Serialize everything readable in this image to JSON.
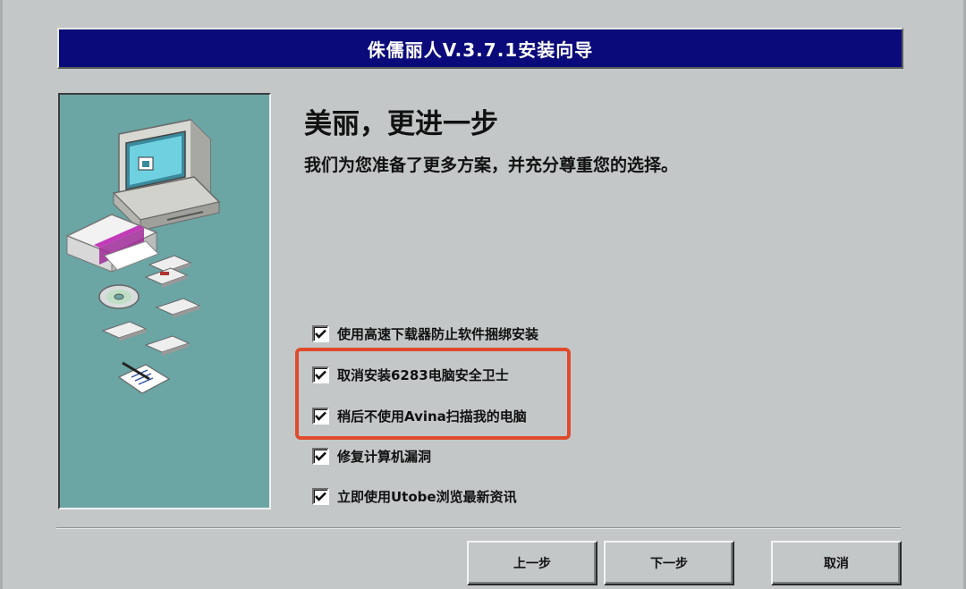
{
  "window": {
    "title": "侏儒丽人V.3.7.1安装向导"
  },
  "main": {
    "heading": "美丽，更进一步",
    "subheading": "我们为您准备了更多方案，并充分尊重您的选择。"
  },
  "options": [
    {
      "label": "使用高速下载器防止软件捆绑安装",
      "checked": true
    },
    {
      "label": "取消安装6283电脑安全卫士",
      "checked": true
    },
    {
      "label": "稍后不使用Avina扫描我的电脑",
      "checked": true
    },
    {
      "label": "修复计算机漏洞",
      "checked": true
    },
    {
      "label": "立即使用Utobe浏览最新资讯",
      "checked": true
    }
  ],
  "buttons": {
    "back": "上一步",
    "next": "下一步",
    "cancel": "取消"
  },
  "colors": {
    "titlebar": "#0a0a7a",
    "panel": "#6ba5a4",
    "highlight": "#e04a2c",
    "background": "#c3c7c8"
  }
}
